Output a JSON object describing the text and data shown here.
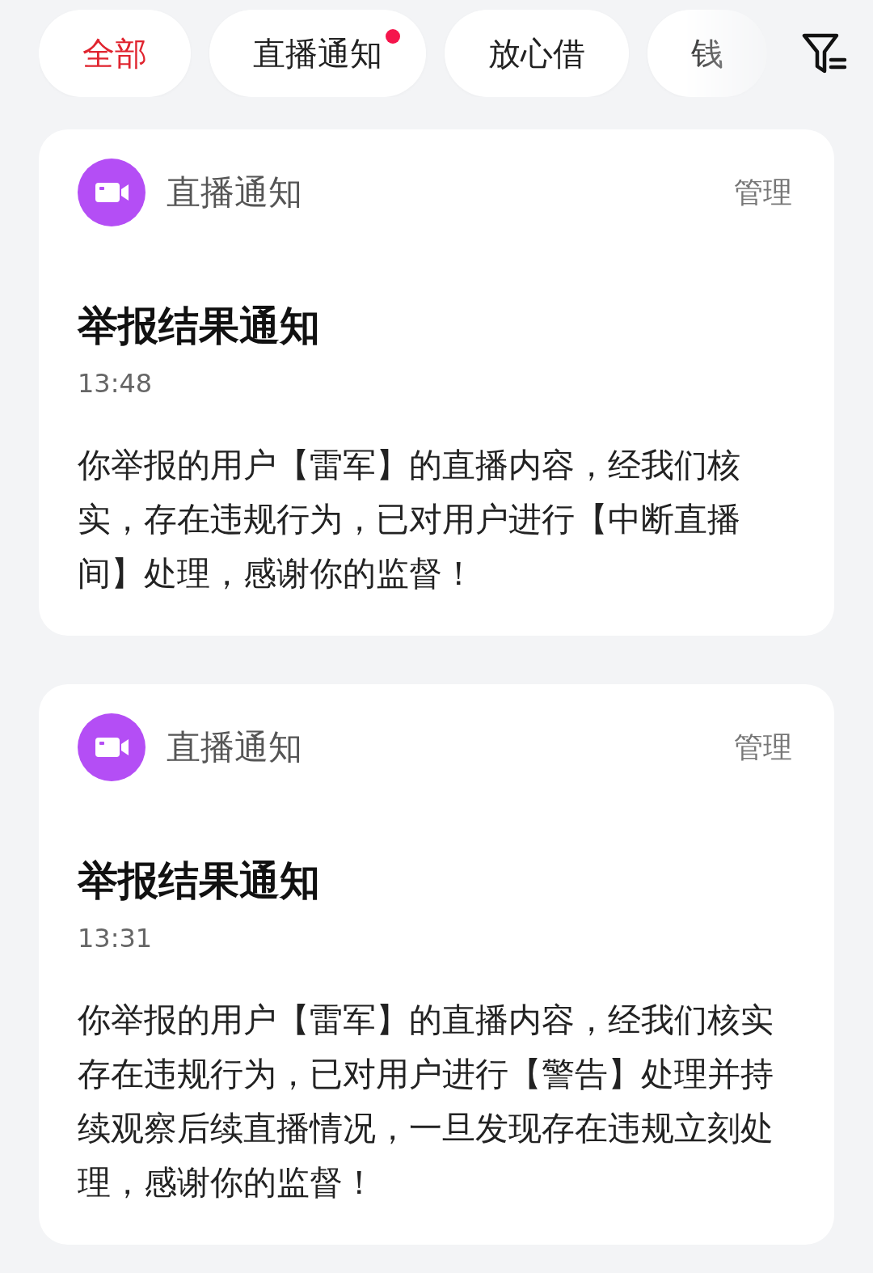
{
  "tabs": [
    {
      "label": "全部",
      "selected": true,
      "badge": false
    },
    {
      "label": "直播通知",
      "selected": false,
      "badge": true
    },
    {
      "label": "放心借",
      "selected": false,
      "badge": false
    },
    {
      "label": "钱",
      "selected": false,
      "badge": false
    }
  ],
  "notifications": [
    {
      "source": "直播通知",
      "manage": "管理",
      "title": "举报结果通知",
      "time": "13:48",
      "body": "你举报的用户【雷军】的直播内容，经我们核实，存在违规行为，已对用户进行【中断直播间】处理，感谢你的监督！"
    },
    {
      "source": "直播通知",
      "manage": "管理",
      "title": "举报结果通知",
      "time": "13:31",
      "body": "你举报的用户【雷军】的直播内容，经我们核实存在违规行为，已对用户进行【警告】处理并持续观察后续直播情况，一旦发现存在违规立刻处理，感谢你的监督！"
    }
  ]
}
